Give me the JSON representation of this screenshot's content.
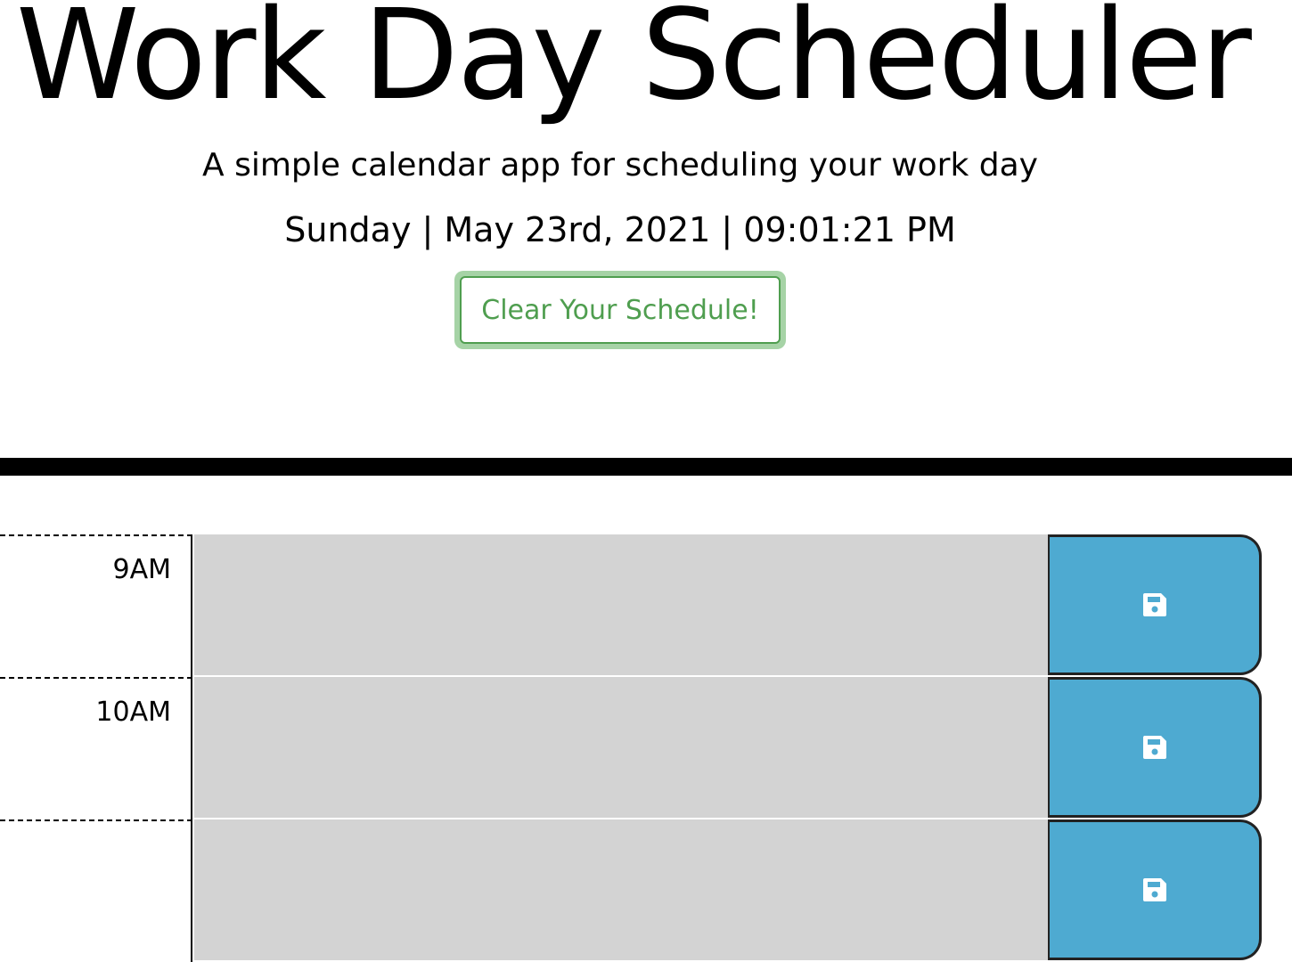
{
  "header": {
    "title": "Work Day Scheduler",
    "lead": "A simple calendar app for scheduling your work day",
    "datetime": "Sunday | May 23rd, 2021 | 09:01:21 PM",
    "clear_label": "Clear Your Schedule!"
  },
  "schedule": {
    "rows": [
      {
        "hour": "9AM",
        "event_text": "",
        "save_icon": "floppy-disk-icon"
      },
      {
        "hour": "10AM",
        "event_text": "",
        "save_icon": "floppy-disk-icon"
      },
      {
        "hour": "",
        "event_text": "",
        "save_icon": "floppy-disk-icon"
      }
    ]
  },
  "colors": {
    "past_block": "#d3d3d3",
    "save_button": "#4eaad1",
    "clear_button_text": "#4f9e4f",
    "clear_button_glow": "#a6d3a6"
  }
}
